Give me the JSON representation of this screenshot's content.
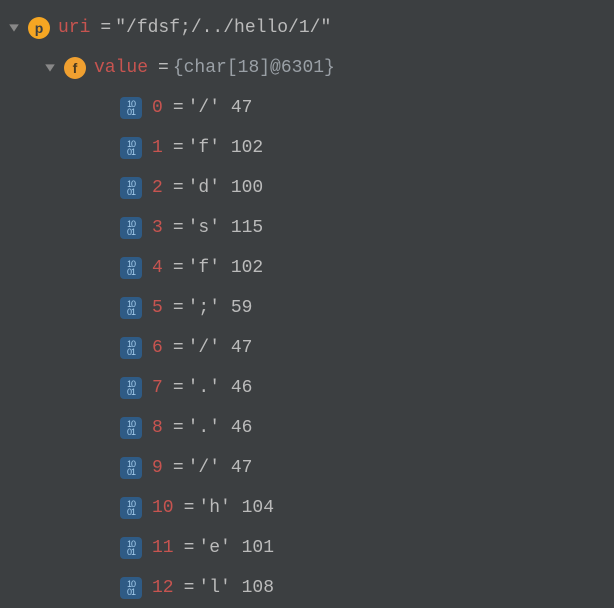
{
  "uri": {
    "name": "uri",
    "value": "\"/fdsf;/../hello/1/\""
  },
  "value_obj": {
    "name": "value",
    "summary": "{char[18]@6301}"
  },
  "chars": [
    {
      "idx": "0",
      "ch": "'/'",
      "code": "47"
    },
    {
      "idx": "1",
      "ch": "'f'",
      "code": "102"
    },
    {
      "idx": "2",
      "ch": "'d'",
      "code": "100"
    },
    {
      "idx": "3",
      "ch": "'s'",
      "code": "115"
    },
    {
      "idx": "4",
      "ch": "'f'",
      "code": "102"
    },
    {
      "idx": "5",
      "ch": "';'",
      "code": "59"
    },
    {
      "idx": "6",
      "ch": "'/'",
      "code": "47"
    },
    {
      "idx": "7",
      "ch": "'.'",
      "code": "46"
    },
    {
      "idx": "8",
      "ch": "'.'",
      "code": "46"
    },
    {
      "idx": "9",
      "ch": "'/'",
      "code": "47"
    },
    {
      "idx": "10",
      "ch": "'h'",
      "code": "104"
    },
    {
      "idx": "11",
      "ch": "'e'",
      "code": "101"
    },
    {
      "idx": "12",
      "ch": "'l'",
      "code": "108"
    }
  ]
}
